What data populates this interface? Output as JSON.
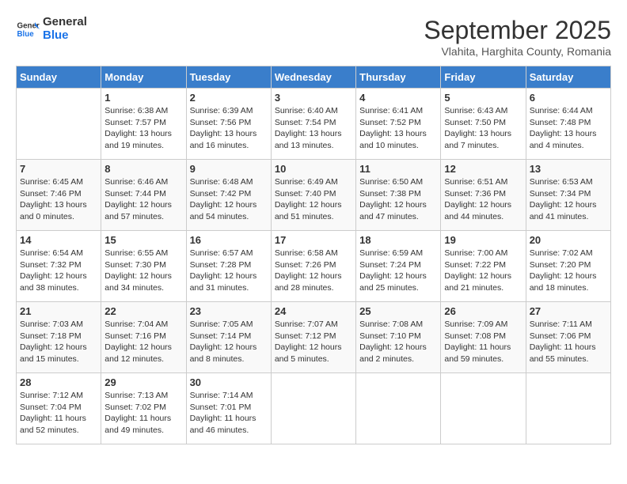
{
  "header": {
    "logo_line1": "General",
    "logo_line2": "Blue",
    "month": "September 2025",
    "location": "Vlahita, Harghita County, Romania"
  },
  "weekdays": [
    "Sunday",
    "Monday",
    "Tuesday",
    "Wednesday",
    "Thursday",
    "Friday",
    "Saturday"
  ],
  "weeks": [
    [
      {
        "day": "",
        "info": ""
      },
      {
        "day": "1",
        "info": "Sunrise: 6:38 AM\nSunset: 7:57 PM\nDaylight: 13 hours\nand 19 minutes."
      },
      {
        "day": "2",
        "info": "Sunrise: 6:39 AM\nSunset: 7:56 PM\nDaylight: 13 hours\nand 16 minutes."
      },
      {
        "day": "3",
        "info": "Sunrise: 6:40 AM\nSunset: 7:54 PM\nDaylight: 13 hours\nand 13 minutes."
      },
      {
        "day": "4",
        "info": "Sunrise: 6:41 AM\nSunset: 7:52 PM\nDaylight: 13 hours\nand 10 minutes."
      },
      {
        "day": "5",
        "info": "Sunrise: 6:43 AM\nSunset: 7:50 PM\nDaylight: 13 hours\nand 7 minutes."
      },
      {
        "day": "6",
        "info": "Sunrise: 6:44 AM\nSunset: 7:48 PM\nDaylight: 13 hours\nand 4 minutes."
      }
    ],
    [
      {
        "day": "7",
        "info": "Sunrise: 6:45 AM\nSunset: 7:46 PM\nDaylight: 13 hours\nand 0 minutes."
      },
      {
        "day": "8",
        "info": "Sunrise: 6:46 AM\nSunset: 7:44 PM\nDaylight: 12 hours\nand 57 minutes."
      },
      {
        "day": "9",
        "info": "Sunrise: 6:48 AM\nSunset: 7:42 PM\nDaylight: 12 hours\nand 54 minutes."
      },
      {
        "day": "10",
        "info": "Sunrise: 6:49 AM\nSunset: 7:40 PM\nDaylight: 12 hours\nand 51 minutes."
      },
      {
        "day": "11",
        "info": "Sunrise: 6:50 AM\nSunset: 7:38 PM\nDaylight: 12 hours\nand 47 minutes."
      },
      {
        "day": "12",
        "info": "Sunrise: 6:51 AM\nSunset: 7:36 PM\nDaylight: 12 hours\nand 44 minutes."
      },
      {
        "day": "13",
        "info": "Sunrise: 6:53 AM\nSunset: 7:34 PM\nDaylight: 12 hours\nand 41 minutes."
      }
    ],
    [
      {
        "day": "14",
        "info": "Sunrise: 6:54 AM\nSunset: 7:32 PM\nDaylight: 12 hours\nand 38 minutes."
      },
      {
        "day": "15",
        "info": "Sunrise: 6:55 AM\nSunset: 7:30 PM\nDaylight: 12 hours\nand 34 minutes."
      },
      {
        "day": "16",
        "info": "Sunrise: 6:57 AM\nSunset: 7:28 PM\nDaylight: 12 hours\nand 31 minutes."
      },
      {
        "day": "17",
        "info": "Sunrise: 6:58 AM\nSunset: 7:26 PM\nDaylight: 12 hours\nand 28 minutes."
      },
      {
        "day": "18",
        "info": "Sunrise: 6:59 AM\nSunset: 7:24 PM\nDaylight: 12 hours\nand 25 minutes."
      },
      {
        "day": "19",
        "info": "Sunrise: 7:00 AM\nSunset: 7:22 PM\nDaylight: 12 hours\nand 21 minutes."
      },
      {
        "day": "20",
        "info": "Sunrise: 7:02 AM\nSunset: 7:20 PM\nDaylight: 12 hours\nand 18 minutes."
      }
    ],
    [
      {
        "day": "21",
        "info": "Sunrise: 7:03 AM\nSunset: 7:18 PM\nDaylight: 12 hours\nand 15 minutes."
      },
      {
        "day": "22",
        "info": "Sunrise: 7:04 AM\nSunset: 7:16 PM\nDaylight: 12 hours\nand 12 minutes."
      },
      {
        "day": "23",
        "info": "Sunrise: 7:05 AM\nSunset: 7:14 PM\nDaylight: 12 hours\nand 8 minutes."
      },
      {
        "day": "24",
        "info": "Sunrise: 7:07 AM\nSunset: 7:12 PM\nDaylight: 12 hours\nand 5 minutes."
      },
      {
        "day": "25",
        "info": "Sunrise: 7:08 AM\nSunset: 7:10 PM\nDaylight: 12 hours\nand 2 minutes."
      },
      {
        "day": "26",
        "info": "Sunrise: 7:09 AM\nSunset: 7:08 PM\nDaylight: 11 hours\nand 59 minutes."
      },
      {
        "day": "27",
        "info": "Sunrise: 7:11 AM\nSunset: 7:06 PM\nDaylight: 11 hours\nand 55 minutes."
      }
    ],
    [
      {
        "day": "28",
        "info": "Sunrise: 7:12 AM\nSunset: 7:04 PM\nDaylight: 11 hours\nand 52 minutes."
      },
      {
        "day": "29",
        "info": "Sunrise: 7:13 AM\nSunset: 7:02 PM\nDaylight: 11 hours\nand 49 minutes."
      },
      {
        "day": "30",
        "info": "Sunrise: 7:14 AM\nSunset: 7:01 PM\nDaylight: 11 hours\nand 46 minutes."
      },
      {
        "day": "",
        "info": ""
      },
      {
        "day": "",
        "info": ""
      },
      {
        "day": "",
        "info": ""
      },
      {
        "day": "",
        "info": ""
      }
    ]
  ]
}
